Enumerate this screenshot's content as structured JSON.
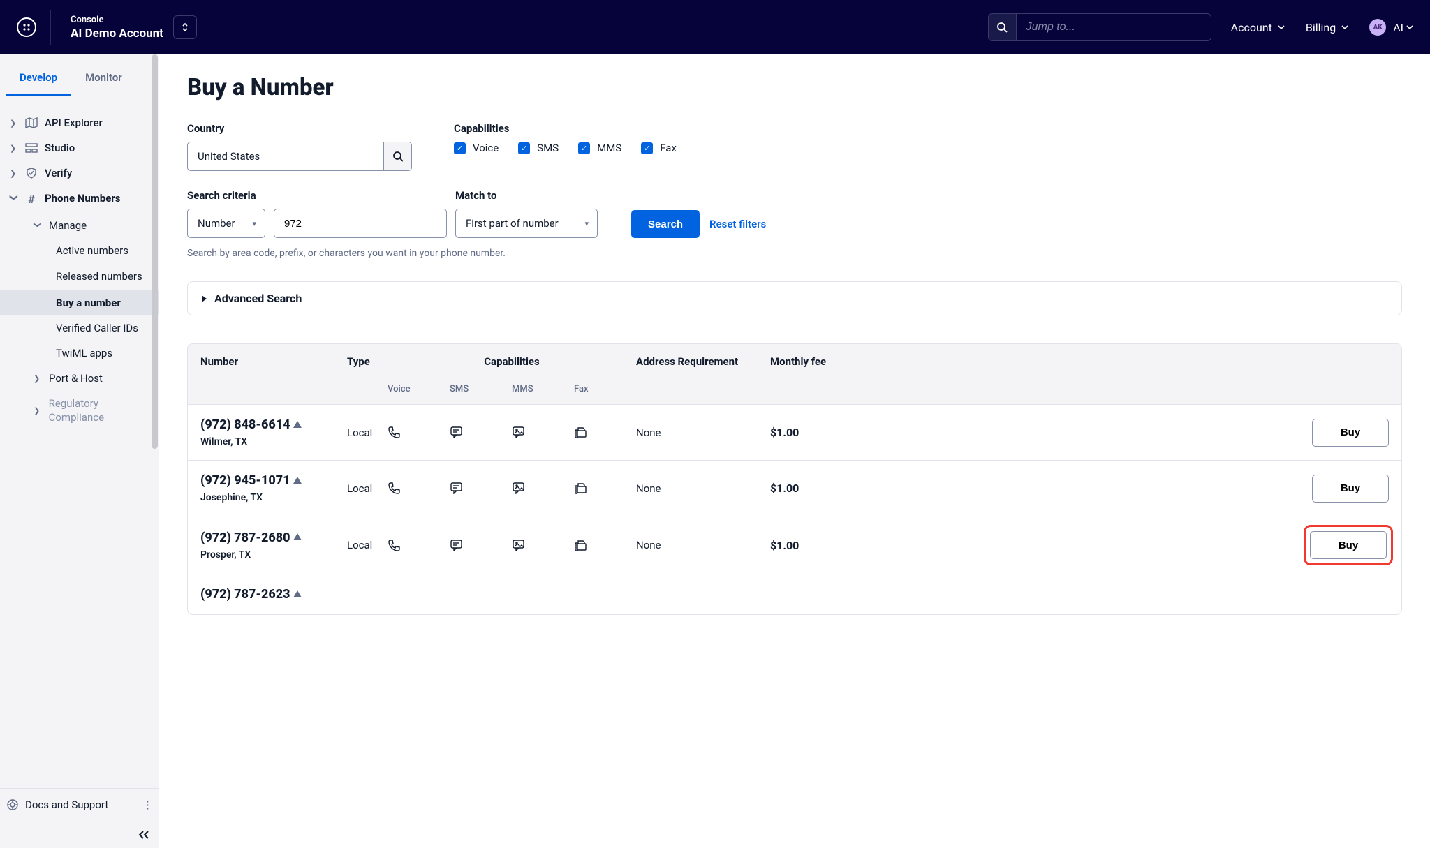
{
  "header": {
    "console_label": "Console",
    "account_name": "AI Demo Account",
    "jump_placeholder": "Jump to...",
    "links": {
      "account": "Account",
      "billing": "Billing"
    },
    "user": {
      "initials": "AK",
      "short": "AI"
    }
  },
  "sidebar": {
    "tabs": {
      "develop": "Develop",
      "monitor": "Monitor"
    },
    "items": {
      "api_explorer": "API Explorer",
      "studio": "Studio",
      "verify": "Verify",
      "phone_numbers": "Phone Numbers",
      "manage": "Manage",
      "active_numbers": "Active numbers",
      "released_numbers": "Released numbers",
      "buy_a_number": "Buy a number",
      "verified_caller_ids": "Verified Caller IDs",
      "twiml_apps": "TwiML apps",
      "port_host": "Port & Host",
      "regulatory": "Regulatory Compliance",
      "docs_support": "Docs and Support"
    }
  },
  "main": {
    "title": "Buy a Number",
    "country_label": "Country",
    "country_value": "United States",
    "capabilities_label": "Capabilities",
    "caps": {
      "voice": "Voice",
      "sms": "SMS",
      "mms": "MMS",
      "fax": "Fax"
    },
    "criteria_label": "Search criteria",
    "criteria_type": "Number",
    "criteria_value": "972",
    "match_label": "Match to",
    "match_value": "First part of number",
    "search_btn": "Search",
    "reset_btn": "Reset filters",
    "hint": "Search by area code, prefix, or characters you want in your phone number.",
    "advanced": "Advanced Search",
    "columns": {
      "number": "Number",
      "type": "Type",
      "capabilities": "Capabilities",
      "voice": "Voice",
      "sms": "SMS",
      "mms": "MMS",
      "fax": "Fax",
      "address": "Address Requirement",
      "fee": "Monthly fee"
    },
    "buy_label": "Buy",
    "rows": [
      {
        "number": "(972) 848-6614",
        "location": "Wilmer, TX",
        "type": "Local",
        "address": "None",
        "fee": "$1.00",
        "highlight": false
      },
      {
        "number": "(972) 945-1071",
        "location": "Josephine, TX",
        "type": "Local",
        "address": "None",
        "fee": "$1.00",
        "highlight": false
      },
      {
        "number": "(972) 787-2680",
        "location": "Prosper, TX",
        "type": "Local",
        "address": "None",
        "fee": "$1.00",
        "highlight": true
      },
      {
        "number": "(972) 787-2623",
        "location": "",
        "type": "",
        "address": "",
        "fee": "",
        "highlight": false
      }
    ]
  }
}
